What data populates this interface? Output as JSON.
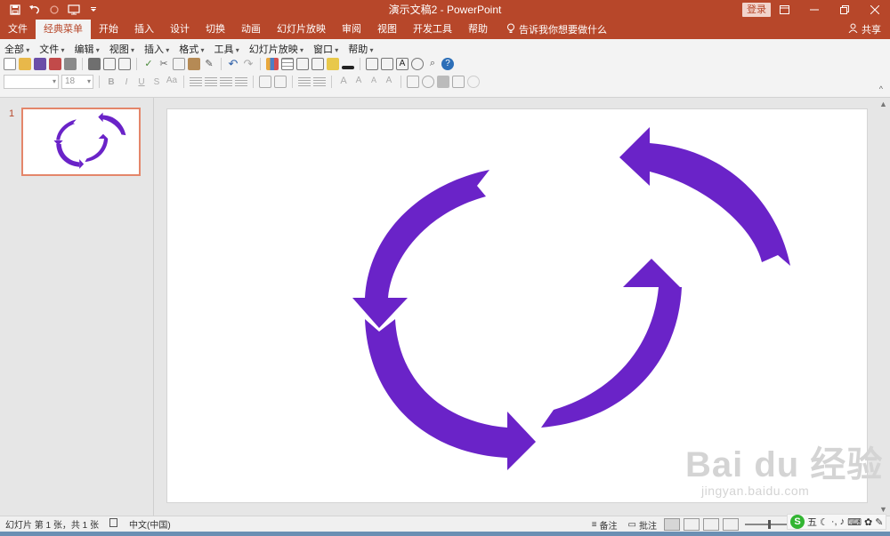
{
  "window": {
    "title": "演示文稿2  -  PowerPoint",
    "login_label": "登录"
  },
  "tabs": [
    {
      "label": "文件"
    },
    {
      "label": "经典菜单",
      "active": true
    },
    {
      "label": "开始"
    },
    {
      "label": "插入"
    },
    {
      "label": "设计"
    },
    {
      "label": "切换"
    },
    {
      "label": "动画"
    },
    {
      "label": "幻灯片放映"
    },
    {
      "label": "审阅"
    },
    {
      "label": "视图"
    },
    {
      "label": "开发工具"
    },
    {
      "label": "帮助"
    }
  ],
  "tell_me": "告诉我你想要做什么",
  "share_label": "共享",
  "classic_menu": [
    "全部",
    "文件",
    "编辑",
    "视图",
    "插入",
    "格式",
    "工具",
    "幻灯片放映",
    "窗口",
    "帮助"
  ],
  "font": {
    "name_value": "",
    "size_value": "18"
  },
  "format_buttons": [
    "B",
    "I",
    "U",
    "S"
  ],
  "slides": [
    {
      "number": "1"
    }
  ],
  "slide_content": {
    "shape": "circular-arrows",
    "fill_color": "#6a23c8"
  },
  "status": {
    "slide_info": "幻灯片 第 1 张，共 1 张",
    "language": "中文(中国)",
    "notes_label": "备注",
    "comments_label": "批注"
  },
  "ime": {
    "mode_label": "五"
  },
  "watermark": {
    "main": "Bai du 经验",
    "sub": "jingyan.baidu.com"
  },
  "colors": {
    "accent": "#b7472a",
    "arrow": "#6a23c8"
  }
}
